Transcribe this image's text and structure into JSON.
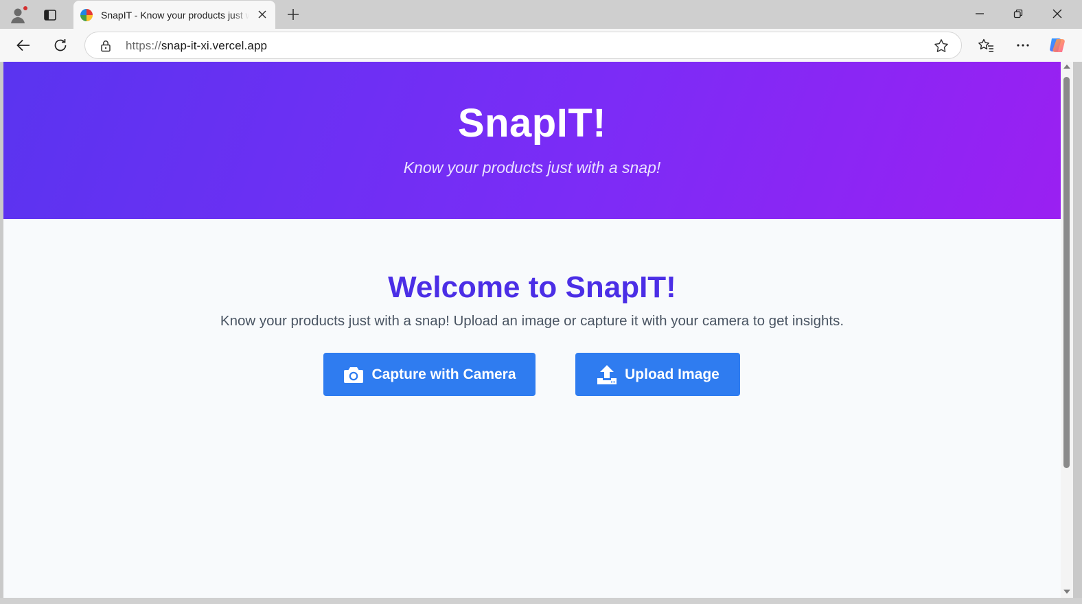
{
  "browser": {
    "tab": {
      "title": "SnapIT - Know your products just with a snap!",
      "favicon": "snapit-favicon"
    },
    "address_bar": {
      "scheme": "https://",
      "host": "snap-it-xi.vercel.app"
    },
    "icons": {
      "profile": "profile-icon",
      "tab_actions": "tab-actions-icon",
      "new_tab": "plus-icon",
      "minimize": "minimize-icon",
      "restore": "restore-icon",
      "close": "close-icon",
      "back": "back-arrow-icon",
      "refresh": "refresh-icon",
      "lock": "lock-icon",
      "favorite": "star-icon",
      "favorites": "favorites-icon",
      "more": "more-icon",
      "copilot": "copilot-icon"
    }
  },
  "page": {
    "hero": {
      "title": "SnapIT!",
      "subtitle": "Know your products just with a snap!"
    },
    "main": {
      "heading": "Welcome to SnapIT!",
      "description": "Know your products just with a snap! Upload an image or capture it with your camera to get insights.",
      "buttons": {
        "camera_label": "Capture with Camera",
        "camera_icon": "camera-icon",
        "upload_label": "Upload Image",
        "upload_icon": "upload-icon"
      }
    }
  },
  "colors": {
    "hero_gradient_start": "#5a34f0",
    "hero_gradient_end": "#9a20f2",
    "heading": "#4b2ee6",
    "button": "#2f7cf0",
    "page_bg": "#f8fafc"
  }
}
